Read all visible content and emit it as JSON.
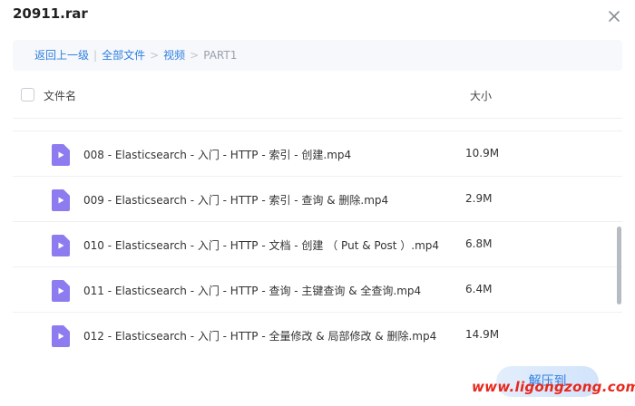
{
  "window": {
    "title": "20911.rar"
  },
  "breadcrumb": {
    "back": "返回上一级",
    "all_files": "全部文件",
    "folder": "视频",
    "current": "PART1",
    "divider": "|",
    "separator": ">"
  },
  "table": {
    "col_name": "文件名",
    "col_size": "大小",
    "rows": [
      {
        "name": "008 - Elasticsearch - 入门 - HTTP - 索引 - 创建.mp4",
        "size": "10.9M"
      },
      {
        "name": "009 - Elasticsearch - 入门 - HTTP - 索引 - 查询 & 删除.mp4",
        "size": "2.9M"
      },
      {
        "name": "010 - Elasticsearch - 入门 - HTTP - 文档 - 创建 （ Put & Post ）.mp4",
        "size": "6.8M"
      },
      {
        "name": "011 - Elasticsearch - 入门 - HTTP - 查询 - 主键查询 & 全查询.mp4",
        "size": "6.4M"
      },
      {
        "name": "012 - Elasticsearch - 入门 - HTTP - 全量修改 & 局部修改 & 删除.mp4",
        "size": "14.9M"
      }
    ]
  },
  "actions": {
    "extract": "解压到"
  },
  "watermark": "www.ligongzong.com",
  "icons": {
    "file": "video-file-icon",
    "close": "close-icon"
  },
  "colors": {
    "accent": "#2f7fe0",
    "file_icon": "#8c7cf0",
    "watermark": "#e8281c"
  }
}
